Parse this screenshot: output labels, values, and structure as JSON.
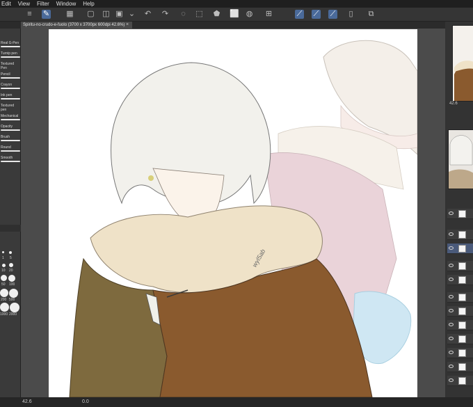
{
  "menu": [
    "Edit",
    "View",
    "Filter",
    "Window",
    "Help"
  ],
  "document_tab": "Spiritu-no-crudo-e-fuolo (3700 x 3700px 600dpi 42.6%)",
  "brushes": [
    "Real G-Pen",
    "Turnip pen",
    "Textured Pen",
    "Pencil",
    "Crayon",
    "Ink pen",
    "Textured pen",
    "Mechanical",
    "Opacity",
    "Brush",
    "Round",
    "Smooth"
  ],
  "brush_sizes": [
    "1",
    "5",
    "10",
    "20",
    "50",
    "100",
    "200",
    "500",
    "1000",
    "2000"
  ],
  "status": {
    "zoom": "42.6",
    "position": "0.0"
  },
  "navigator": {
    "zoom": "42.6"
  },
  "signature": "wyl5ab"
}
